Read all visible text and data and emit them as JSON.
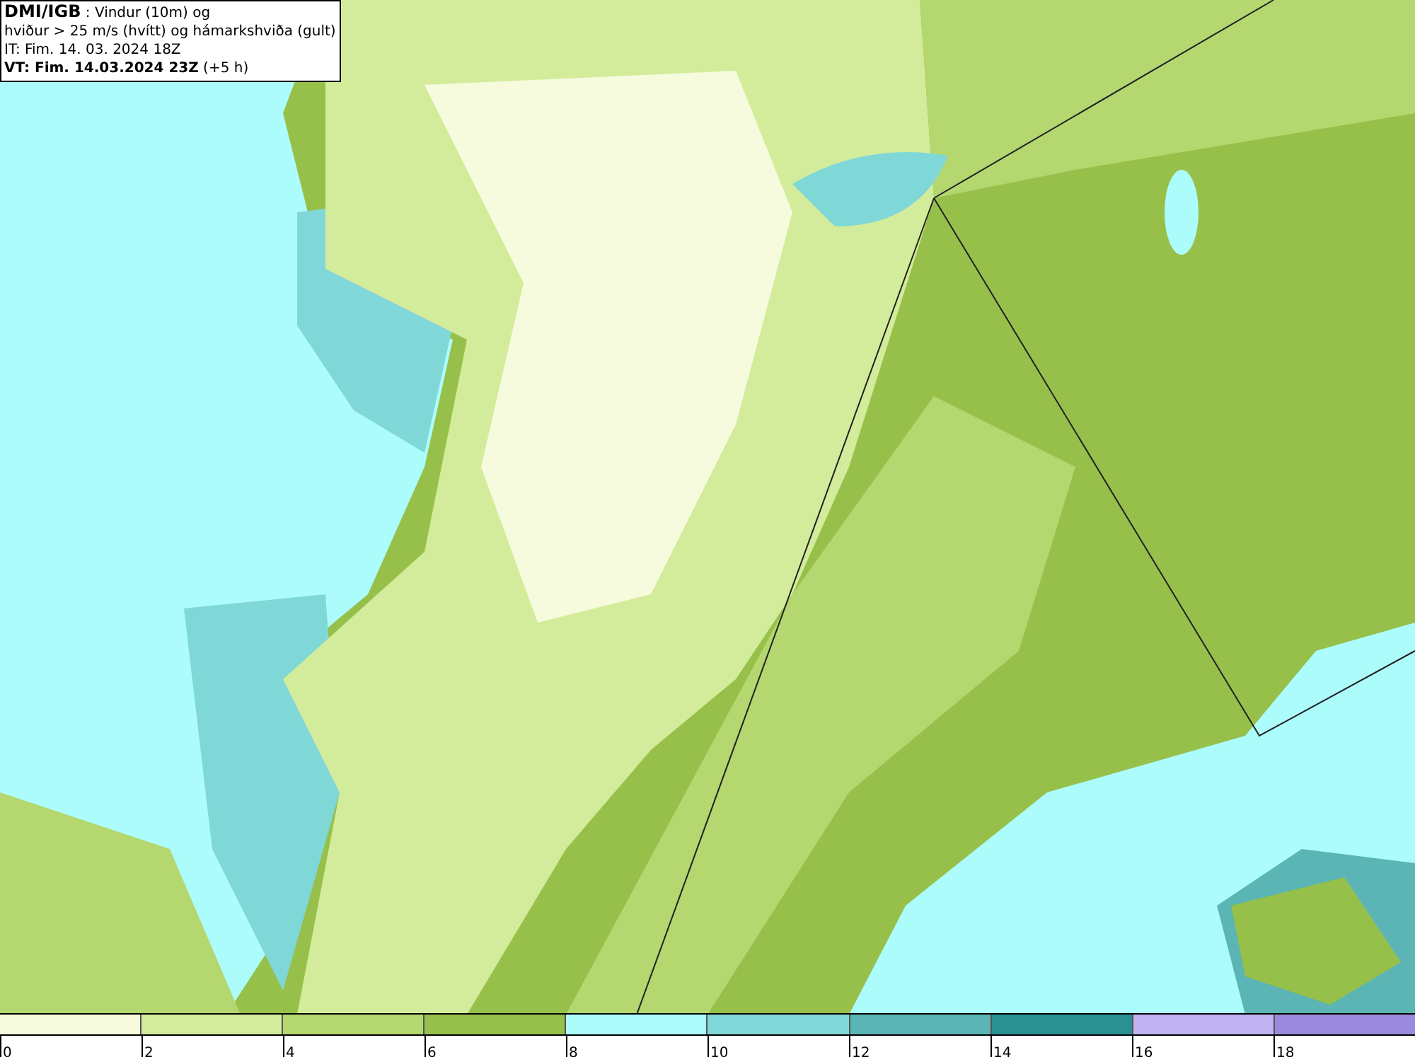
{
  "title_box": {
    "lines": [
      "**DMI/IGB** : Vindur (10m) og",
      "hviður > 25 m/s (hvítt) og hámarkshviða (gult)",
      "IT: Fim. 14. 03. 2024 18Z",
      "**VT: Fim. 14.03.2024 23Z** (+5 h)"
    ]
  },
  "legend": {
    "segments": [
      {
        "color": "#f6fbdd"
      },
      {
        "color": "#d3ec9b"
      },
      {
        "color": "#b4d770"
      },
      {
        "color": "#97c04b"
      },
      {
        "color": "#acfcfc"
      },
      {
        "color": "#80d7d7"
      },
      {
        "color": "#5bb5b5"
      },
      {
        "color": "#2a9191"
      },
      {
        "color": "#c1b2f2"
      },
      {
        "color": "#9b8ade"
      }
    ],
    "ticks": [
      "0",
      "2",
      "4",
      "6",
      "8",
      "10",
      "12",
      "14",
      "16",
      "18"
    ]
  }
}
